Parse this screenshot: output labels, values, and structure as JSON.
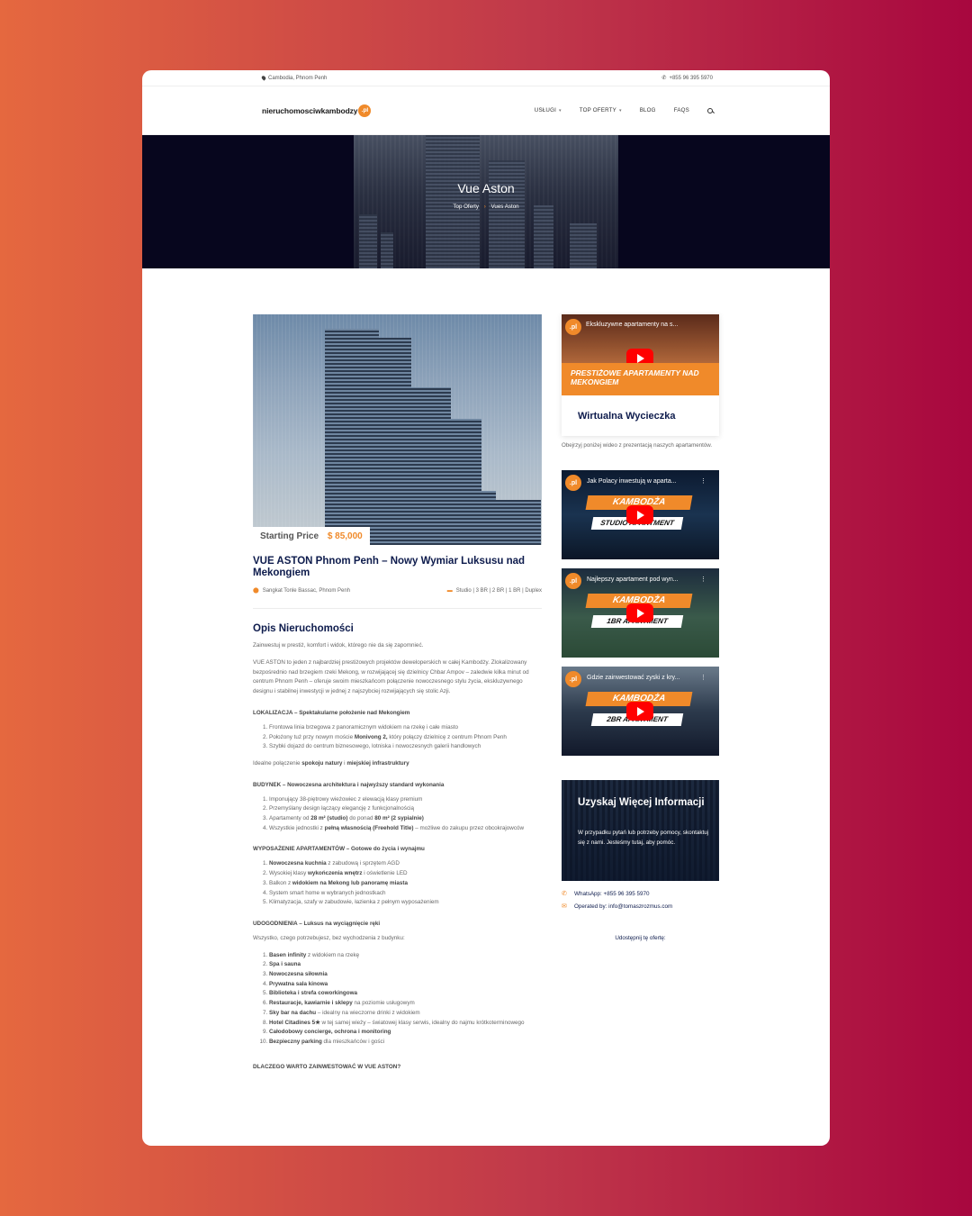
{
  "topbar": {
    "location": "Cambodia, Phnom Penh",
    "phone": "+855 96 395 5970"
  },
  "nav": {
    "logo_text": "nieruchomosciwkambodzy",
    "logo_badge": ".pl",
    "menu": [
      {
        "label": "USŁUGI",
        "caret": "▾"
      },
      {
        "label": "TOP OFERTY",
        "caret": "▾"
      },
      {
        "label": "BLOG",
        "caret": ""
      },
      {
        "label": "FAQS",
        "caret": ""
      }
    ]
  },
  "hero": {
    "title": "Vue Aston",
    "crumb_parent": "Top Oferty",
    "crumb_sep": "›",
    "crumb_current": "Vues Aston"
  },
  "listing": {
    "price_label": "Starting Price",
    "price_value": "$ 85,000",
    "title": "VUE ASTON Phnom Penh – Nowy Wymiar Luksusu nad Mekongiem",
    "address": "Sangkat Tonle Bassac, Phnom Penh",
    "types": "Studio | 3 BR | 2 BR | 1 BR | Duplex"
  },
  "description": {
    "heading": "Opis Nieruchomości",
    "intro": "Zainwestuj w prestiż, komfort i widok, którego nie da się zapomnieć.",
    "para": "VUE ASTON to jeden z najbardziej prestiżowych projektów deweloperskich w całej Kambodży. Zlokalizowany bezpośrednio nad brzegiem rzeki Mekong, w rozwijającej się dzielnicy Chbar Ampov – zaledwie kilka minut od centrum Phnom Penh – oferuje swoim mieszkańcom połączenie nowoczesnego stylu życia, ekskluzywnego designu i stabilnej inwestycji w jednej z najszybciej rozwijających się stolic Azji.",
    "s1_title": "LOKALIZACJA – Spektakularne położenie nad Mekongiem",
    "s1_items": [
      {
        "pre": "Frontowa linia brzegowa z panoramicznym widokiem na rzekę i całe miasto",
        "bold": "",
        "post": ""
      },
      {
        "pre": "Położony tuż przy nowym moście ",
        "bold": "Monivong 2,",
        "post": " który połączy dzielnicę z centrum Phnom Penh"
      },
      {
        "pre": "Szybki dojazd do centrum biznesowego, lotniska i nowoczesnych galerii handlowych",
        "bold": "",
        "post": ""
      }
    ],
    "s1_after_pre": "Idealne połączenie ",
    "s1_after_b1": "spokoju natury",
    "s1_after_mid": " i ",
    "s1_after_b2": "miejskiej infrastruktury",
    "s2_title": "BUDYNEK – Nowoczesna architektura i najwyższy standard wykonania",
    "s2_items": [
      {
        "pre": "Imponujący 38-piętrowy wieżowiec z elewacją klasy premium",
        "bold": "",
        "post": ""
      },
      {
        "pre": "Przemyślany design łączący elegancję z funkcjonalnością",
        "bold": "",
        "post": ""
      },
      {
        "pre": "Apartamenty od ",
        "bold": "28 m² (studio)",
        "post": " do ponad ",
        "bold2": "80 m² (2 sypialnie)"
      },
      {
        "pre": "Wszystkie jednostki z ",
        "bold": "pełną własnością (Freehold Title)",
        "post": " – możliwe do zakupu przez obcokrajowców"
      }
    ],
    "s3_title": "WYPOSAŻENIE APARTAMENTÓW – Gotowe do życia i wynajmu",
    "s3_items": [
      {
        "pre": "",
        "bold": "Nowoczesna kuchnia",
        "post": " z zabudową i sprzętem AGD"
      },
      {
        "pre": "Wysokiej klasy ",
        "bold": "wykończenia wnętrz",
        "post": " i oświetlenie LED"
      },
      {
        "pre": "Balkon z ",
        "bold": "widokiem na Mekong lub panoramę miasta",
        "post": ""
      },
      {
        "pre": "System smart home w wybranych jednostkach",
        "bold": "",
        "post": ""
      },
      {
        "pre": "Klimatyzacja, szafy w zabudowie, łazienka z pełnym wyposażeniem",
        "bold": "",
        "post": ""
      }
    ],
    "s4_title": "UDOGODNIENIA – Luksus na wyciągnięcie ręki",
    "s4_intro": "Wszystko, czego potrzebujesz, bez wychodzenia z budynku:",
    "s4_items": [
      {
        "bold": "Basen infinity",
        "post": " z widokiem na rzekę"
      },
      {
        "bold": "Spa i sauna",
        "post": ""
      },
      {
        "bold": "Nowoczesna siłownia",
        "post": ""
      },
      {
        "bold": "Prywatna sala kinowa",
        "post": ""
      },
      {
        "bold": "Biblioteka i strefa coworkingowa",
        "post": ""
      },
      {
        "bold": "Restauracje, kawiarnie i sklepy",
        "post": " na poziomie usługowym"
      },
      {
        "bold": "Sky bar na dachu",
        "post": " – idealny na wieczorne drinki z widokiem"
      },
      {
        "bold": "Hotel Citadines 5★",
        "post": " w tej samej wieży – światowej klasy serwis, idealny do najmu krótkoterminowego"
      },
      {
        "bold": "Całodobowy concierge, ochrona i monitoring",
        "post": ""
      },
      {
        "bold": "Bezpieczny parking",
        "post": " dla mieszkańców i gości"
      }
    ],
    "s5_title": "DLACZEGO WARTO ZAINWESTOWAĆ W VUE ASTON?"
  },
  "sidebar": {
    "channel_badge": ".pl",
    "video1": {
      "title": "Ekskluzywne apartamenty na s...",
      "banner": "PRESTIŻOWE APARTAMENTY NAD MEKONGIEM"
    },
    "tour_title": "Wirtualna Wycieczka",
    "tour_note": "Obejrzyj poniżej wideo z prezentacją naszych apartamentów.",
    "videos": [
      {
        "title": "Jak Polacy inwestują w aparta...",
        "kam": "KAMBODŻA",
        "sub": "STUDIO APARTMENT"
      },
      {
        "title": "Najlepszy apartament pod wyn...",
        "kam": "KAMBODŻA",
        "sub": "1BR APARTMENT"
      },
      {
        "title": "Gdzie zainwestować zyski z kry...",
        "kam": "KAMBODŻA",
        "sub": "2BR APARTMENT"
      }
    ],
    "info_title": "Uzyskaj Więcej Informacji",
    "info_text": "W przypadku pytań lub potrzeby pomocy, skontaktuj się z nami. Jesteśmy tutaj, aby pomóc.",
    "whatsapp": "WhatsApp: +855 96 395 5970",
    "email": "Operated by: info@tomaszrozmus.com",
    "share": "Udostępnij tę ofertę:"
  }
}
